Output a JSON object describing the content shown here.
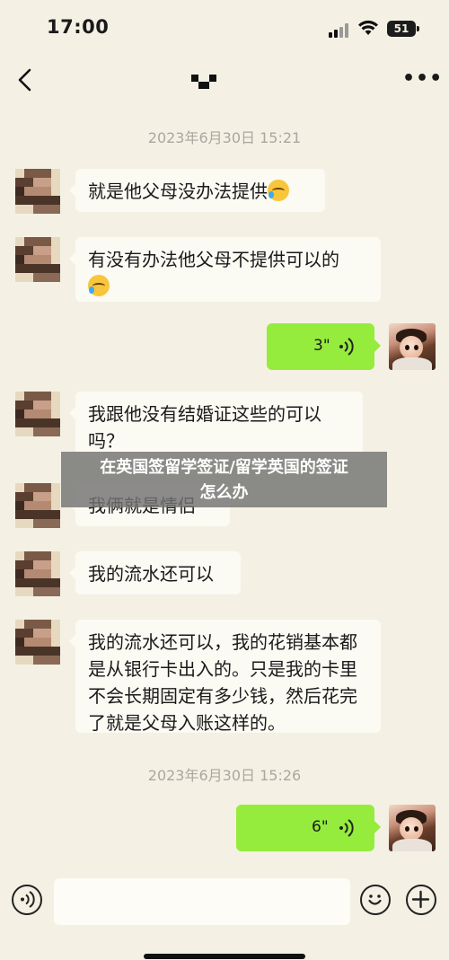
{
  "status_bar": {
    "time": "17:00",
    "battery": "51"
  },
  "nav": {
    "back_icon": "chevron-left-icon",
    "more_label": "•••"
  },
  "timestamps": [
    "2023年6月30日 15:21",
    "2023年6月30日 15:26"
  ],
  "messages": [
    {
      "side": "in",
      "text": "就是他父母没办法提供",
      "emoji": "crying-laughing-emoji"
    },
    {
      "side": "in",
      "text": "有没有办法他父母不提供可以的",
      "emoji": "crying-laughing-emoji"
    },
    {
      "side": "out",
      "type": "voice",
      "duration": "3\""
    },
    {
      "side": "in",
      "text": "我跟他没有结婚证这些的可以吗？"
    },
    {
      "side": "in",
      "text": "我俩就是情侣"
    },
    {
      "side": "in",
      "text": "我的流水还可以"
    },
    {
      "side": "in",
      "text": "我的流水还可以，我的花销基本都是从银行卡出入的。只是我的卡里不会长期固定有多少钱，然后花完了就是父母入账这样的。"
    },
    {
      "side": "out",
      "type": "voice",
      "duration": "6\""
    }
  ],
  "overlay": {
    "line1": "在英国签留学签证/留学英国的签证",
    "line2": "怎么办"
  },
  "input_bar": {
    "placeholder": ""
  },
  "colors": {
    "background": "#f4f1e4",
    "bubble_out": "#95ec3c",
    "bubble_in": "#fbfaf3",
    "timestamp": "#a9a7a0"
  }
}
